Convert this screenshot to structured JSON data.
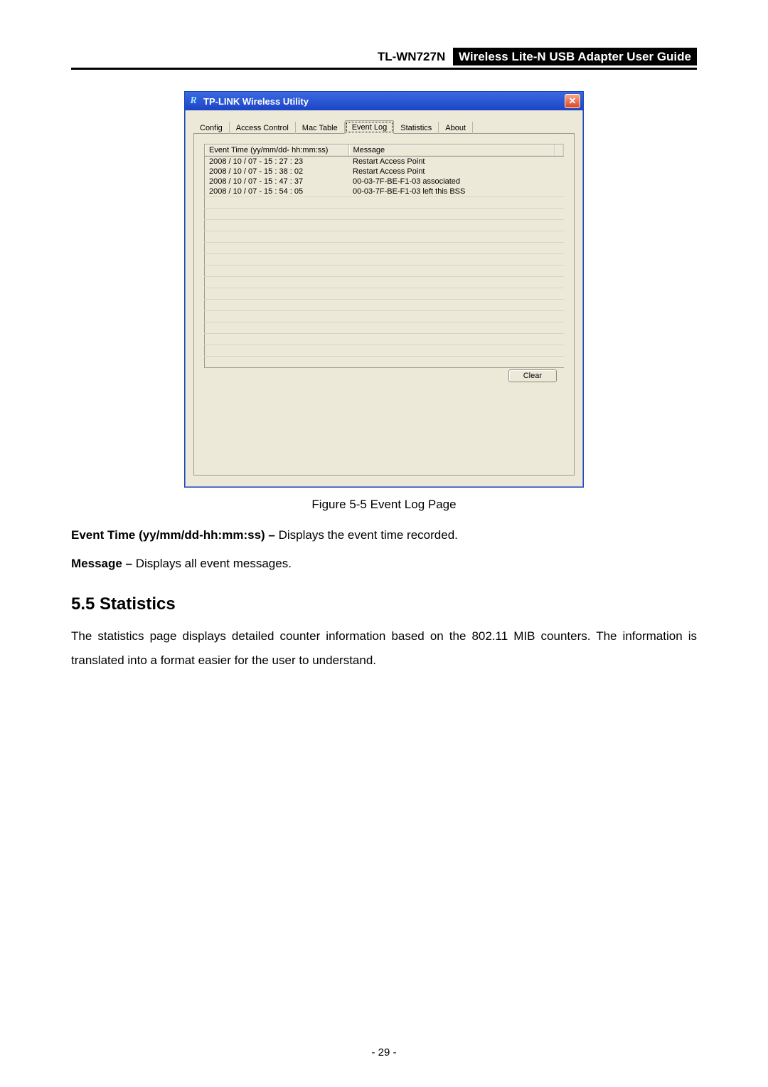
{
  "header": {
    "model": "TL-WN727N",
    "title": "Wireless Lite-N USB Adapter User Guide"
  },
  "window": {
    "title": "TP-LINK Wireless Utility",
    "app_icon_glyph": "R",
    "close_glyph": "✕",
    "tabs": {
      "config": "Config",
      "access_control": "Access Control",
      "mac_table": "Mac Table",
      "event_log": "Event Log",
      "statistics": "Statistics",
      "about": "About"
    },
    "event_log": {
      "col_time": "Event Time (yy/mm/dd- hh:mm:ss)",
      "col_msg": "Message",
      "rows": [
        {
          "time": "2008 / 10 / 07 - 15 : 27 : 23",
          "msg": "Restart Access Point"
        },
        {
          "time": "2008 / 10 / 07 - 15 : 38 : 02",
          "msg": "Restart Access Point"
        },
        {
          "time": "2008 / 10 / 07 - 15 : 47 : 37",
          "msg": "00-03-7F-BE-F1-03 associated"
        },
        {
          "time": "2008 / 10 / 07 - 15 : 54 : 05",
          "msg": "00-03-7F-BE-F1-03 left this BSS"
        }
      ],
      "blank_rows": 15,
      "clear_label": "Clear"
    }
  },
  "caption": "Figure 5-5 Event Log Page",
  "para_event_time_bold": "Event Time (yy/mm/dd-hh:mm:ss) –",
  "para_event_time_rest": " Displays the event time recorded.",
  "para_message_bold": "Message –",
  "para_message_rest": " Displays all event messages.",
  "section_heading": "5.5  Statistics",
  "section_body": "The statistics page displays detailed counter information based on the 802.11 MIB counters. The information is translated into a format easier for the user to understand.",
  "page_number": "- 29 -"
}
